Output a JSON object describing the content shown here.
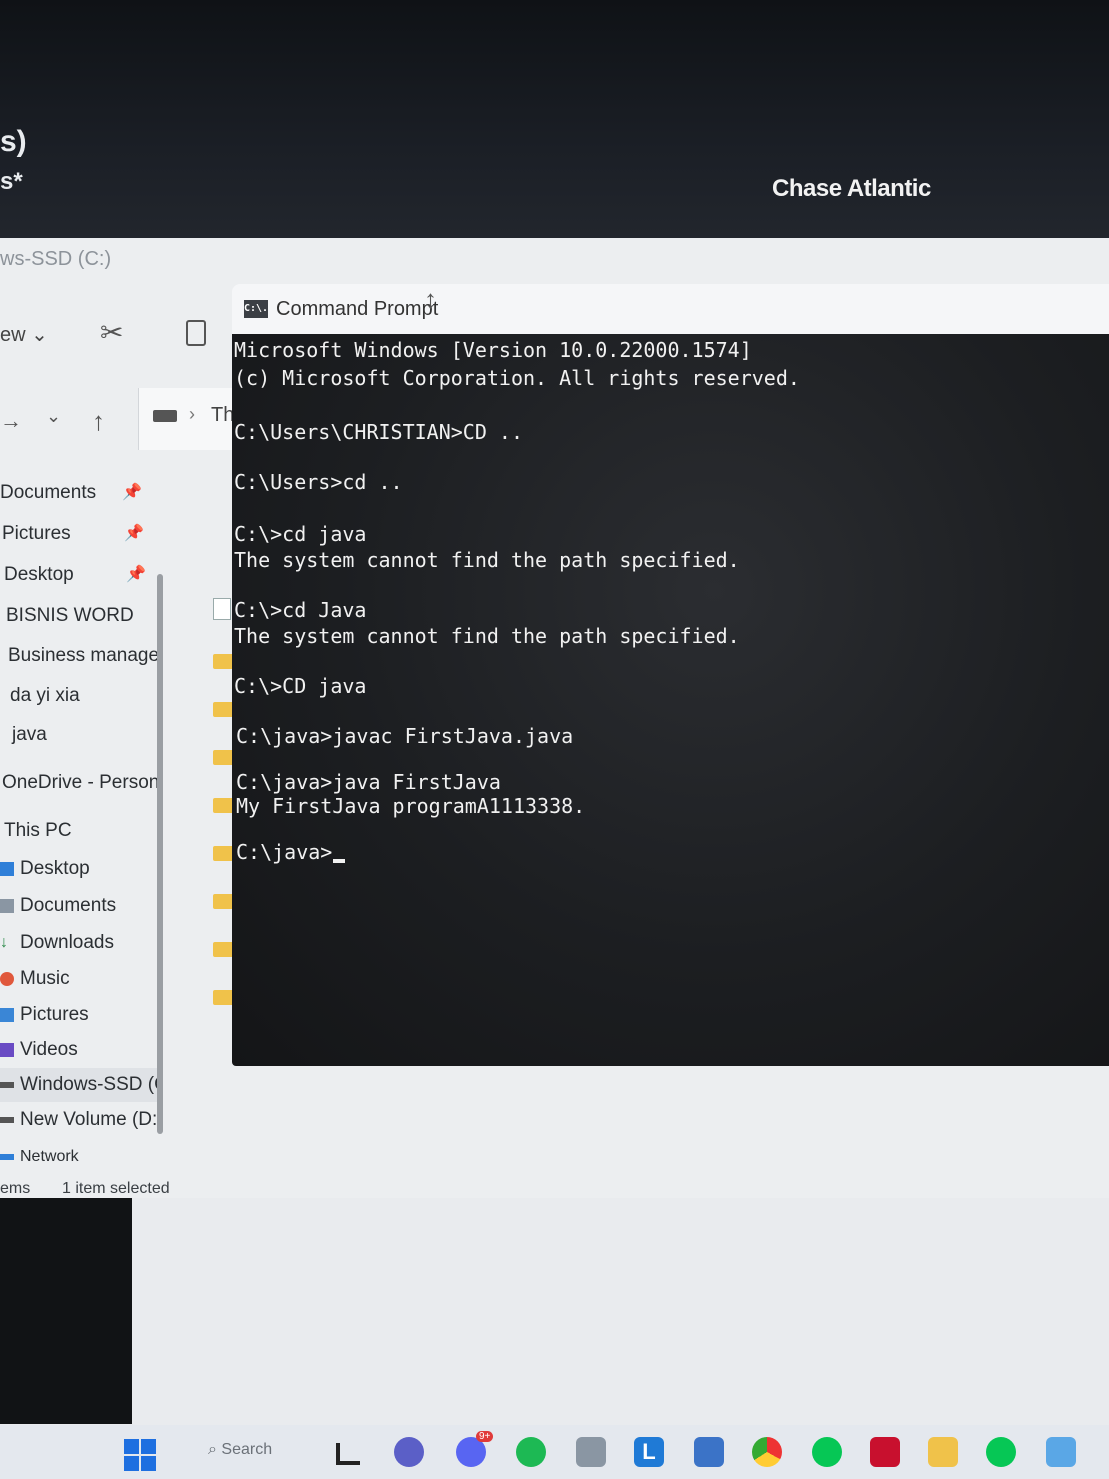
{
  "wallpaper": {
    "glyph_top": "s)",
    "glyph_bottom": "s*",
    "now_playing_artist": "Chase Atlantic"
  },
  "explorer": {
    "window_title": "ws-SSD (C:)",
    "view_menu_label": "ew",
    "address_crumb": "Th",
    "nav_items": [
      {
        "label": "Documents",
        "pinned": true
      },
      {
        "label": "Pictures",
        "pinned": true
      },
      {
        "label": "Desktop",
        "pinned": true
      },
      {
        "label": "BISNIS WORD",
        "pinned": false
      },
      {
        "label": "Business manage",
        "pinned": false
      },
      {
        "label": "da yi xia",
        "pinned": false
      },
      {
        "label": "java",
        "pinned": false
      },
      {
        "label": "OneDrive - Person",
        "pinned": false
      },
      {
        "label": "This PC",
        "pinned": false
      },
      {
        "label": "Desktop",
        "pinned": false
      },
      {
        "label": "Documents",
        "pinned": false
      },
      {
        "label": "Downloads",
        "pinned": false
      },
      {
        "label": "Music",
        "pinned": false
      },
      {
        "label": "Pictures",
        "pinned": false
      },
      {
        "label": "Videos",
        "pinned": false
      },
      {
        "label": "Windows-SSD (C",
        "pinned": false
      },
      {
        "label": "New Volume (D:",
        "pinned": false
      },
      {
        "label": "Network",
        "pinned": false
      }
    ],
    "status_items": "ems",
    "status_selected": "1 item selected"
  },
  "cmd": {
    "window_title": "Command Prompt",
    "app_icon_text": "C:\\.",
    "lines": [
      "Microsoft Windows [Version 10.0.22000.1574]",
      "(c) Microsoft Corporation. All rights reserved.",
      "C:\\Users\\CHRISTIAN>CD ..",
      "C:\\Users>cd ..",
      "C:\\>cd java",
      "The system cannot find the path specified.",
      "C:\\>cd Java",
      "The system cannot find the path specified.",
      "C:\\>CD java",
      "C:\\java>javac FirstJava.java",
      "C:\\java>java FirstJava",
      "My FirstJava programA1113338.",
      "C:\\java>"
    ]
  },
  "taskbar": {
    "search_label": "Search",
    "discord_badge": "9+",
    "pinned_apps": [
      "file-explorer",
      "teams-video",
      "discord",
      "spotify",
      "camera",
      "l-app",
      "network-app",
      "chrome",
      "line",
      "mcafee",
      "folder",
      "line-2",
      "notepad"
    ]
  },
  "colors": {
    "cmd_background": "#1c1e21",
    "cmd_text": "#f1f1f1",
    "folder_yellow": "#f0c24a",
    "start_blue": "#1e6fe0",
    "spotify_green": "#1db954"
  }
}
